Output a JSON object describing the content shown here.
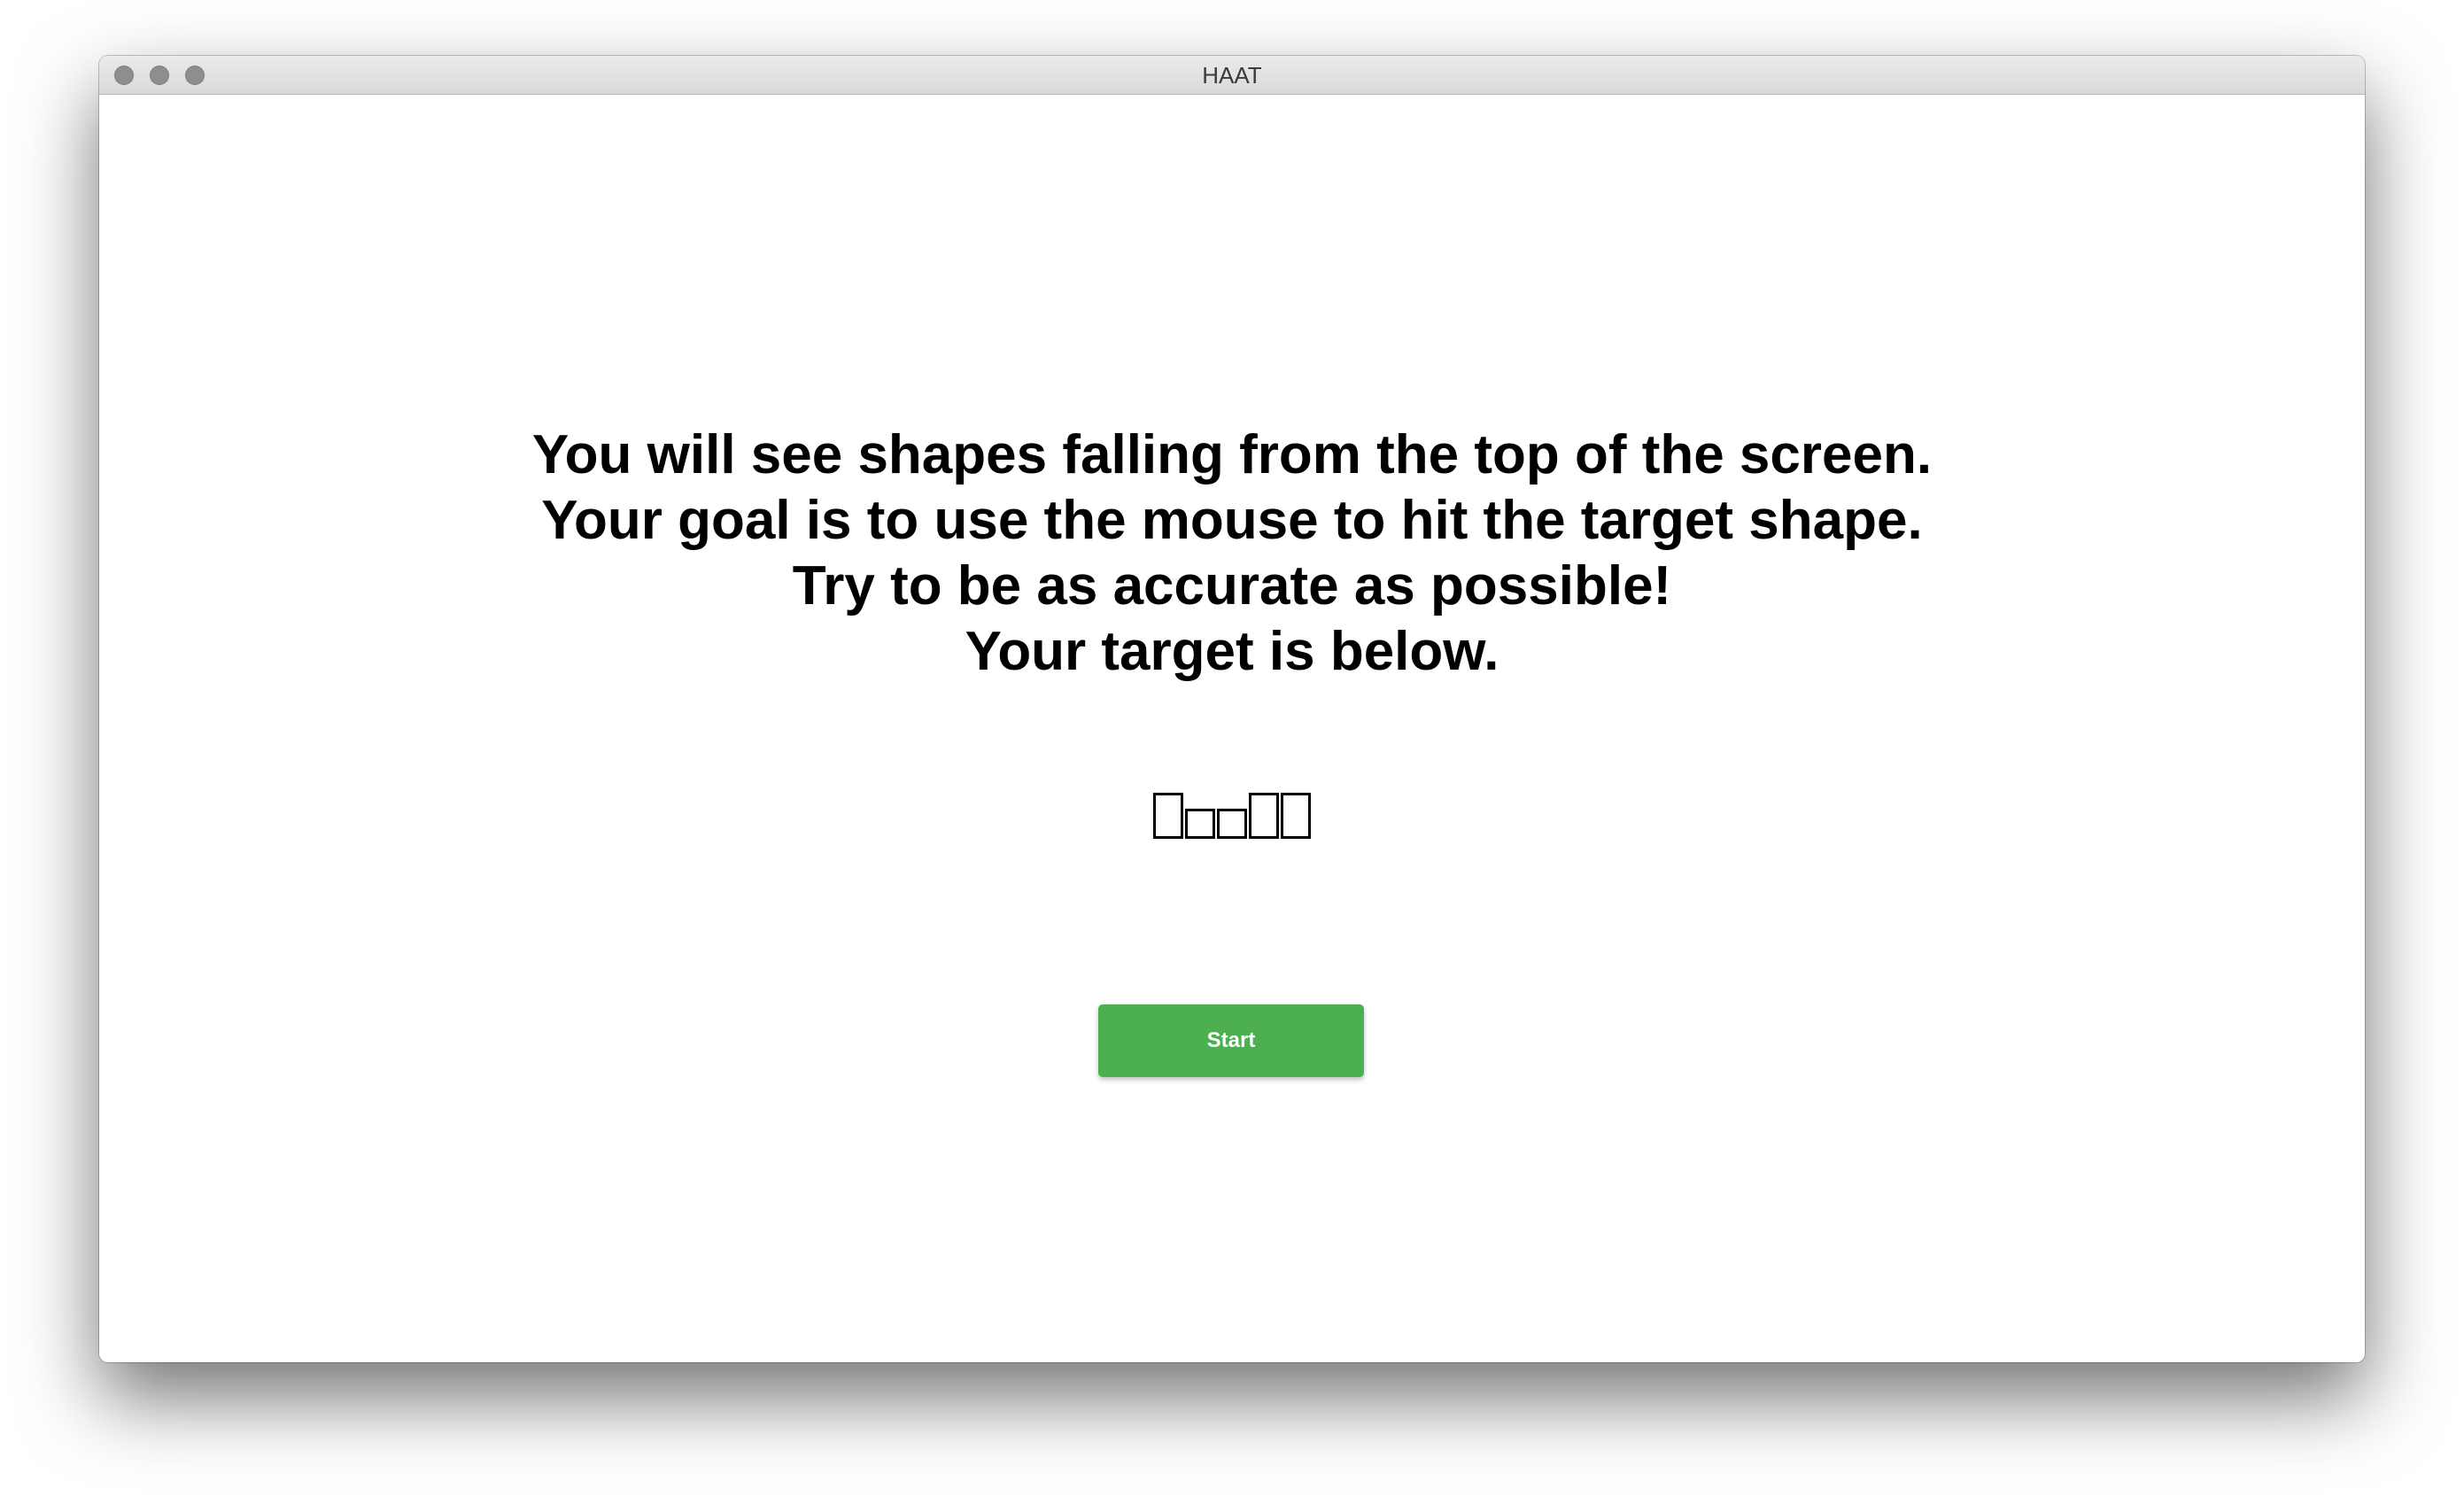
{
  "window": {
    "title": "HAAT"
  },
  "instructions": {
    "line1": "You will see shapes falling from the top of the screen.",
    "line2": "Your goal is to use the mouse to hit the target shape.",
    "line3": "Try to be as accurate as possible!",
    "line4": "Your target is below."
  },
  "target": {
    "glyphs": [
      "tall",
      "short",
      "short",
      "tall",
      "tall"
    ]
  },
  "start_button": {
    "label": "Start",
    "color": "#4caf50"
  }
}
